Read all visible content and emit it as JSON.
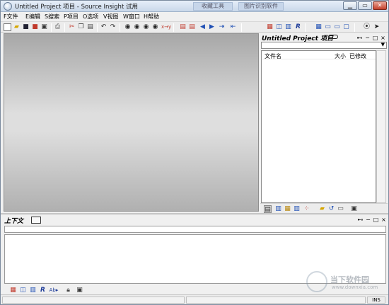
{
  "window": {
    "title": "Untitled Project 项目 - Source Insight 试用",
    "ghost_tabs": [
      "收藏工具",
      "图片识别软件"
    ],
    "controls": [
      "▁",
      "▭",
      "✕"
    ]
  },
  "menu": [
    "F文件",
    "E编辑",
    "S搜索",
    "P项目",
    "O选项",
    "V视图",
    "W窗口",
    "H帮助"
  ],
  "toolbar": {
    "icons": [
      "new-file",
      "open-folder",
      "save",
      "save-all",
      "save-copy",
      "print",
      "cut",
      "copy",
      "paste",
      "undo",
      "redo",
      "search-binoculars",
      "search-prev",
      "search-next",
      "search-files",
      "replace",
      "bookmark",
      "bookmark-list",
      "back",
      "forward",
      "jump-out",
      "jump-in",
      "book-sym",
      "sym-window",
      "relation-window",
      "layout",
      "context-window",
      "windows",
      "project-window",
      "browse-ref",
      "pointer"
    ]
  },
  "project_panel": {
    "title": "Untitled Project 项目",
    "columns": {
      "name": "文件名",
      "size": "大小",
      "modified": "已修改"
    }
  },
  "context_panel": {
    "title": "上下文"
  },
  "statusbar": {
    "mode": "INS"
  },
  "watermark": {
    "name": "当下软件园",
    "url": "www.downxia.com"
  }
}
